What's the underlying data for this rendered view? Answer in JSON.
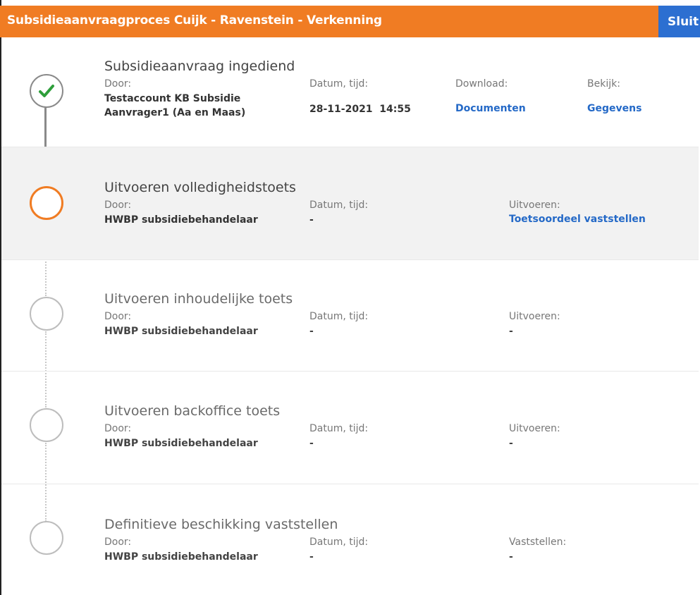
{
  "header": {
    "title": "Subsidieaanvraagproces Cuijk - Ravenstein - Verkenning",
    "close_label": "Sluit"
  },
  "colors": {
    "header_bg": "#F07C23",
    "close_bg": "#2C6FD1",
    "link": "#2469C7",
    "check": "#2E9E3A"
  },
  "steps": [
    {
      "status": "done",
      "status_icon": "checkmark-icon",
      "title": "Subsidieaanvraag ingediend",
      "door_label": "Door:",
      "door_value": "Testaccount KB Subsidie Aanvrager1 (Aa en Maas)",
      "datum_label": "Datum, tijd:",
      "datum_value": "28-11-2021  14:55",
      "download_label": "Download:",
      "download_link": "Documenten",
      "bekijk_label": "Bekijk:",
      "bekijk_link": "Gegevens"
    },
    {
      "status": "current",
      "title": "Uitvoeren volledigheidstoets",
      "door_label": "Door:",
      "door_value": "HWBP subsidiebehandelaar",
      "datum_label": "Datum, tijd:",
      "datum_value": "-",
      "action_label": "Uitvoeren:",
      "action_link": "Toetsoordeel vaststellen"
    },
    {
      "status": "pending",
      "title": "Uitvoeren inhoudelijke toets",
      "door_label": "Door:",
      "door_value": "HWBP subsidiebehandelaar",
      "datum_label": "Datum, tijd:",
      "datum_value": "-",
      "action_label": "Uitvoeren:",
      "action_value": "-"
    },
    {
      "status": "pending",
      "title": "Uitvoeren backoffice toets",
      "door_label": "Door:",
      "door_value": "HWBP subsidiebehandelaar",
      "datum_label": "Datum, tijd:",
      "datum_value": "-",
      "action_label": "Uitvoeren:",
      "action_value": "-"
    },
    {
      "status": "pending",
      "title": "Definitieve beschikking vaststellen",
      "door_label": "Door:",
      "door_value": "HWBP subsidiebehandelaar",
      "datum_label": "Datum, tijd:",
      "datum_value": "-",
      "action_label": "Vaststellen:",
      "action_value": "-"
    }
  ]
}
